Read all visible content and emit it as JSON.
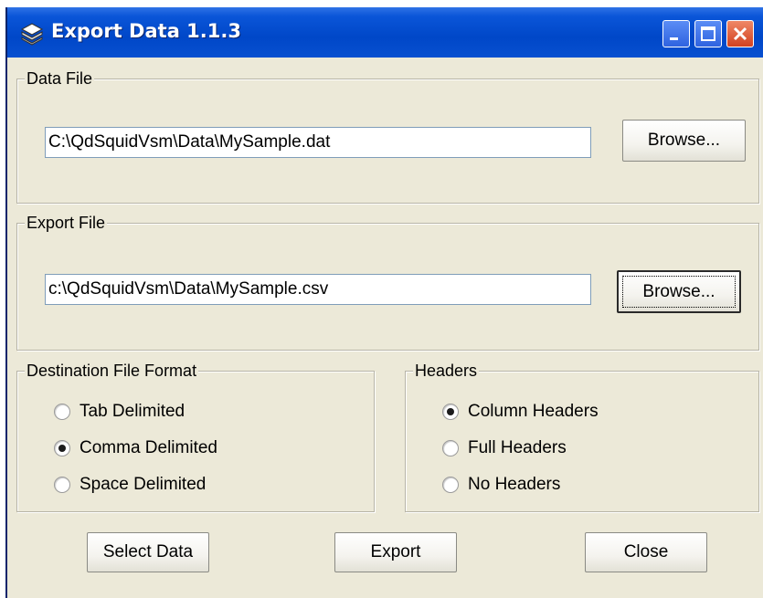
{
  "window": {
    "title": "Export Data 1.1.3",
    "controls": [
      "minimize-icon",
      "maximize-icon",
      "close-icon"
    ]
  },
  "data_file": {
    "label": "Data File",
    "path": "C:\\QdSquidVsm\\Data\\MySample.dat",
    "browse_label": "Browse..."
  },
  "export_file": {
    "label": "Export File",
    "path": "c:\\QdSquidVsm\\Data\\MySample.csv",
    "browse_label": "Browse..."
  },
  "format": {
    "label": "Destination File Format",
    "options": [
      {
        "label": "Tab Delimited",
        "checked": false
      },
      {
        "label": "Comma Delimited",
        "checked": true
      },
      {
        "label": "Space Delimited",
        "checked": false
      }
    ]
  },
  "headers": {
    "label": "Headers",
    "options": [
      {
        "label": "Column Headers",
        "checked": true
      },
      {
        "label": "Full Headers",
        "checked": false
      },
      {
        "label": "No Headers",
        "checked": false
      }
    ]
  },
  "buttons": {
    "select_data": "Select Data",
    "export": "Export",
    "close": "Close"
  },
  "colors": {
    "titlebar": "#0047c8",
    "dialog_bg": "#ece9d8",
    "close_button": "#d24120"
  }
}
